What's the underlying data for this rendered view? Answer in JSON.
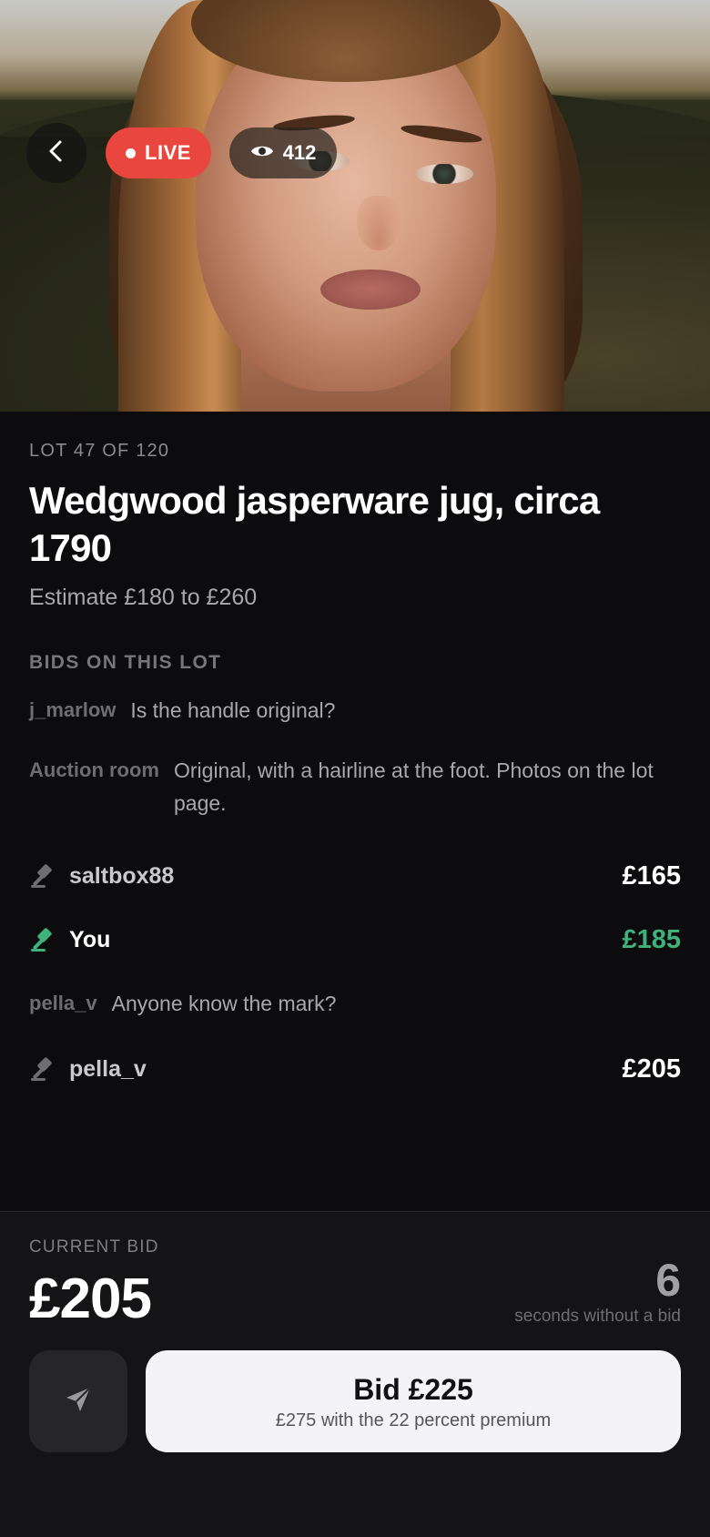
{
  "header": {
    "live_label": "LIVE",
    "viewers": "412"
  },
  "lot": {
    "meta": "LOT 47 OF 120",
    "title": "Wedgwood jasperware jug, circa 1790",
    "estimate": "Estimate £180 to £260"
  },
  "feed": {
    "heading": "BIDS ON THIS LOT",
    "items": [
      {
        "type": "message",
        "author": "j_marlow",
        "text": "Is the handle original?"
      },
      {
        "type": "message",
        "author": "Auction room",
        "text": "Original, with a hairline at the foot. Photos on the lot page."
      },
      {
        "type": "bid",
        "name": "saltbox88",
        "amount": "£165",
        "is_you": false
      },
      {
        "type": "bid",
        "name": "You",
        "amount": "£185",
        "is_you": true
      },
      {
        "type": "message",
        "author": "pella_v",
        "text": "Anyone know the mark?"
      },
      {
        "type": "bid",
        "name": "pella_v",
        "amount": "£205",
        "is_you": false
      }
    ]
  },
  "bottom": {
    "current_label": "CURRENT BID",
    "current_value": "£205",
    "timer_value": "6",
    "timer_label": "seconds without a bid",
    "bid_button_label": "Bid £225",
    "bid_button_sub": "£275 with the 22 percent premium"
  },
  "colors": {
    "live": "#e8463e",
    "you_bid": "#3fb27a",
    "background": "#0c0c0e",
    "panel": "#141417"
  },
  "icons": {
    "back": "chevron-left-icon",
    "viewers": "eye-icon",
    "bid": "gavel-icon",
    "send": "paper-plane-icon"
  }
}
